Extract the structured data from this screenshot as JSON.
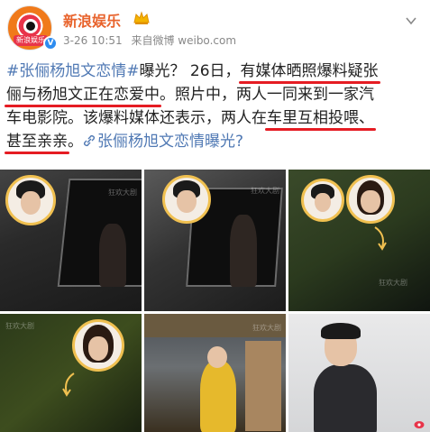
{
  "header": {
    "avatar_tag": "新浪娱乐",
    "verified_mark": "V",
    "username": "新浪娱乐",
    "time": "3-26 10:51",
    "source": "来自微博 weibo.com"
  },
  "post": {
    "lines": [
      [
        {
          "t": "#张俪杨旭文恋情#",
          "k": "hash"
        },
        {
          "t": "曝光？ 26日，",
          "k": "text"
        },
        {
          "t": "有媒体晒照爆料疑张",
          "k": "ul"
        }
      ],
      [
        {
          "t": "俪与杨旭文正在恋爱中",
          "k": "ul"
        },
        {
          "t": "。照片中，两人一同来到一家汽",
          "k": "text"
        }
      ],
      [
        {
          "t": "车电影院。该爆料媒体还表示，两人在",
          "k": "text"
        },
        {
          "t": "车里互相投喂、",
          "k": "ul"
        }
      ],
      [
        {
          "t": "甚至亲亲",
          "k": "ul"
        },
        {
          "t": "。",
          "k": "text"
        },
        {
          "t": "张俪杨旭文恋情曝光?",
          "k": "link"
        }
      ]
    ]
  },
  "photos": {
    "watermark": "狂欢大剧",
    "count": 6
  }
}
